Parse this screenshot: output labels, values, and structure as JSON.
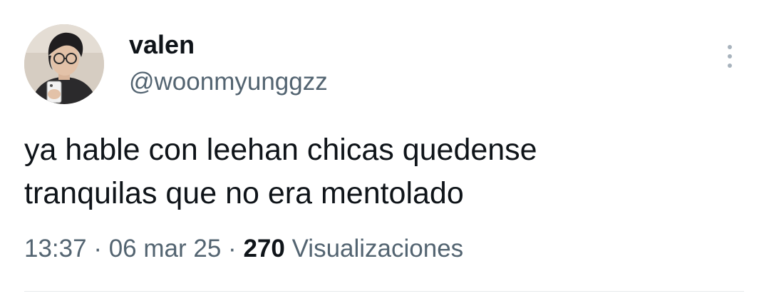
{
  "user": {
    "display_name": "valen",
    "handle": "@woonmyunggzz",
    "avatar_icon": "profile-photo"
  },
  "post": {
    "text": "ya hable con leehan chicas quedense\ntranquilas que no era mentolado"
  },
  "meta": {
    "time": "13:37",
    "separator": "·",
    "date": "06 mar 25",
    "views_count": "270",
    "views_label": "Visualizaciones"
  },
  "actions": {
    "more_icon": "more-vertical-icon"
  },
  "colors": {
    "primary_text": "#0f1419",
    "secondary_text": "#536471",
    "more_dots": "#a8b3bd",
    "divider": "#e6e9eb"
  }
}
